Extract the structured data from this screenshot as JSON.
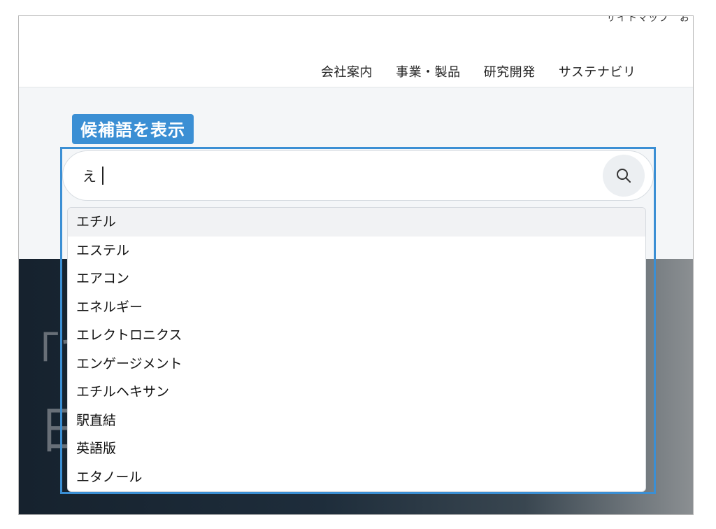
{
  "header": {
    "utility_link": "サイトマップ　お",
    "nav": [
      {
        "label": "会社案内"
      },
      {
        "label": "事業・製品"
      },
      {
        "label": "研究開発"
      },
      {
        "label": "サステナビリ"
      }
    ]
  },
  "annotation": {
    "label": "候補語を表示",
    "color": "#3b8fd4"
  },
  "search": {
    "value": "え",
    "icon": "search-icon"
  },
  "suggestions": [
    {
      "label": "エチル",
      "active": true
    },
    {
      "label": "エステル"
    },
    {
      "label": "エアコン"
    },
    {
      "label": "エネルギー"
    },
    {
      "label": "エレクトロニクス"
    },
    {
      "label": "エンゲージメント"
    },
    {
      "label": "エチルヘキサン"
    },
    {
      "label": "駅直結"
    },
    {
      "label": "英語版"
    },
    {
      "label": "エタノール"
    }
  ],
  "hero": {
    "glyph_top": "「て",
    "glyph_bottom": "日"
  }
}
